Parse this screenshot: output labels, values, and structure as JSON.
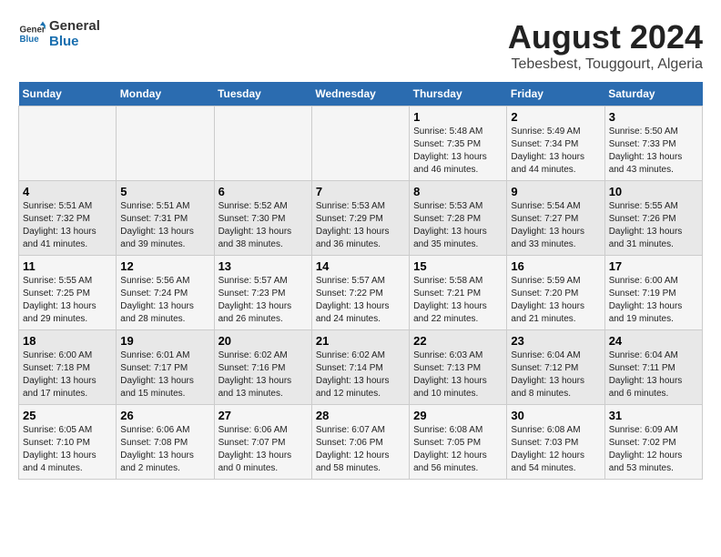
{
  "logo": {
    "line1": "General",
    "line2": "Blue"
  },
  "title": "August 2024",
  "subtitle": "Tebesbest, Touggourt, Algeria",
  "headers": [
    "Sunday",
    "Monday",
    "Tuesday",
    "Wednesday",
    "Thursday",
    "Friday",
    "Saturday"
  ],
  "weeks": [
    [
      {
        "num": "",
        "info": ""
      },
      {
        "num": "",
        "info": ""
      },
      {
        "num": "",
        "info": ""
      },
      {
        "num": "",
        "info": ""
      },
      {
        "num": "1",
        "info": "Sunrise: 5:48 AM\nSunset: 7:35 PM\nDaylight: 13 hours\nand 46 minutes."
      },
      {
        "num": "2",
        "info": "Sunrise: 5:49 AM\nSunset: 7:34 PM\nDaylight: 13 hours\nand 44 minutes."
      },
      {
        "num": "3",
        "info": "Sunrise: 5:50 AM\nSunset: 7:33 PM\nDaylight: 13 hours\nand 43 minutes."
      }
    ],
    [
      {
        "num": "4",
        "info": "Sunrise: 5:51 AM\nSunset: 7:32 PM\nDaylight: 13 hours\nand 41 minutes."
      },
      {
        "num": "5",
        "info": "Sunrise: 5:51 AM\nSunset: 7:31 PM\nDaylight: 13 hours\nand 39 minutes."
      },
      {
        "num": "6",
        "info": "Sunrise: 5:52 AM\nSunset: 7:30 PM\nDaylight: 13 hours\nand 38 minutes."
      },
      {
        "num": "7",
        "info": "Sunrise: 5:53 AM\nSunset: 7:29 PM\nDaylight: 13 hours\nand 36 minutes."
      },
      {
        "num": "8",
        "info": "Sunrise: 5:53 AM\nSunset: 7:28 PM\nDaylight: 13 hours\nand 35 minutes."
      },
      {
        "num": "9",
        "info": "Sunrise: 5:54 AM\nSunset: 7:27 PM\nDaylight: 13 hours\nand 33 minutes."
      },
      {
        "num": "10",
        "info": "Sunrise: 5:55 AM\nSunset: 7:26 PM\nDaylight: 13 hours\nand 31 minutes."
      }
    ],
    [
      {
        "num": "11",
        "info": "Sunrise: 5:55 AM\nSunset: 7:25 PM\nDaylight: 13 hours\nand 29 minutes."
      },
      {
        "num": "12",
        "info": "Sunrise: 5:56 AM\nSunset: 7:24 PM\nDaylight: 13 hours\nand 28 minutes."
      },
      {
        "num": "13",
        "info": "Sunrise: 5:57 AM\nSunset: 7:23 PM\nDaylight: 13 hours\nand 26 minutes."
      },
      {
        "num": "14",
        "info": "Sunrise: 5:57 AM\nSunset: 7:22 PM\nDaylight: 13 hours\nand 24 minutes."
      },
      {
        "num": "15",
        "info": "Sunrise: 5:58 AM\nSunset: 7:21 PM\nDaylight: 13 hours\nand 22 minutes."
      },
      {
        "num": "16",
        "info": "Sunrise: 5:59 AM\nSunset: 7:20 PM\nDaylight: 13 hours\nand 21 minutes."
      },
      {
        "num": "17",
        "info": "Sunrise: 6:00 AM\nSunset: 7:19 PM\nDaylight: 13 hours\nand 19 minutes."
      }
    ],
    [
      {
        "num": "18",
        "info": "Sunrise: 6:00 AM\nSunset: 7:18 PM\nDaylight: 13 hours\nand 17 minutes."
      },
      {
        "num": "19",
        "info": "Sunrise: 6:01 AM\nSunset: 7:17 PM\nDaylight: 13 hours\nand 15 minutes."
      },
      {
        "num": "20",
        "info": "Sunrise: 6:02 AM\nSunset: 7:16 PM\nDaylight: 13 hours\nand 13 minutes."
      },
      {
        "num": "21",
        "info": "Sunrise: 6:02 AM\nSunset: 7:14 PM\nDaylight: 13 hours\nand 12 minutes."
      },
      {
        "num": "22",
        "info": "Sunrise: 6:03 AM\nSunset: 7:13 PM\nDaylight: 13 hours\nand 10 minutes."
      },
      {
        "num": "23",
        "info": "Sunrise: 6:04 AM\nSunset: 7:12 PM\nDaylight: 13 hours\nand 8 minutes."
      },
      {
        "num": "24",
        "info": "Sunrise: 6:04 AM\nSunset: 7:11 PM\nDaylight: 13 hours\nand 6 minutes."
      }
    ],
    [
      {
        "num": "25",
        "info": "Sunrise: 6:05 AM\nSunset: 7:10 PM\nDaylight: 13 hours\nand 4 minutes."
      },
      {
        "num": "26",
        "info": "Sunrise: 6:06 AM\nSunset: 7:08 PM\nDaylight: 13 hours\nand 2 minutes."
      },
      {
        "num": "27",
        "info": "Sunrise: 6:06 AM\nSunset: 7:07 PM\nDaylight: 13 hours\nand 0 minutes."
      },
      {
        "num": "28",
        "info": "Sunrise: 6:07 AM\nSunset: 7:06 PM\nDaylight: 12 hours\nand 58 minutes."
      },
      {
        "num": "29",
        "info": "Sunrise: 6:08 AM\nSunset: 7:05 PM\nDaylight: 12 hours\nand 56 minutes."
      },
      {
        "num": "30",
        "info": "Sunrise: 6:08 AM\nSunset: 7:03 PM\nDaylight: 12 hours\nand 54 minutes."
      },
      {
        "num": "31",
        "info": "Sunrise: 6:09 AM\nSunset: 7:02 PM\nDaylight: 12 hours\nand 53 minutes."
      }
    ]
  ]
}
